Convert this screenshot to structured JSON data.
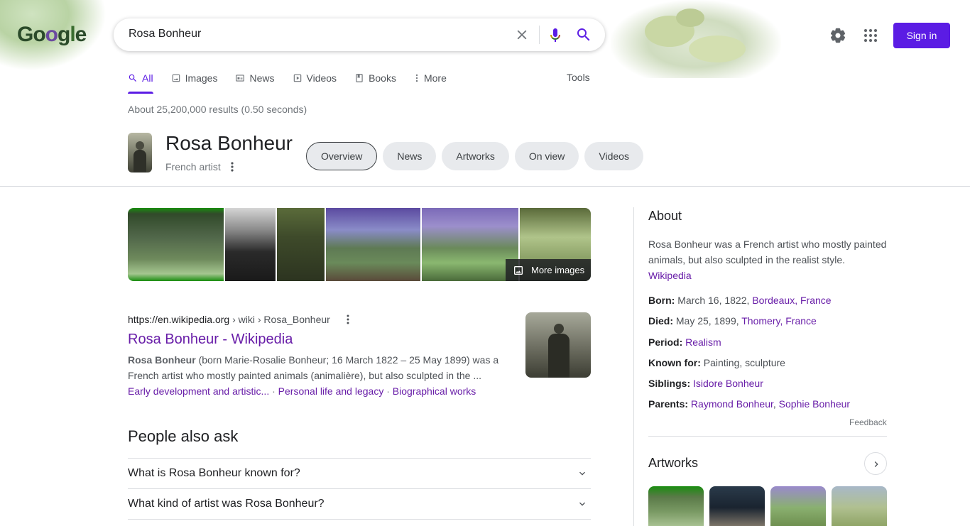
{
  "header": {
    "logo_text": "Google",
    "search_query": "Rosa Bonheur",
    "sign_in": "Sign in"
  },
  "tabs": [
    {
      "label": "All",
      "icon": "search-icon"
    },
    {
      "label": "Images",
      "icon": "image-icon"
    },
    {
      "label": "News",
      "icon": "news-icon"
    },
    {
      "label": "Videos",
      "icon": "video-icon"
    },
    {
      "label": "Books",
      "icon": "book-icon"
    },
    {
      "label": "More",
      "icon": "more-vert-icon"
    }
  ],
  "tools_label": "Tools",
  "result_stats": "About 25,200,000 results (0.50 seconds)",
  "entity": {
    "title": "Rosa Bonheur",
    "subtitle": "French artist",
    "chips": [
      "Overview",
      "News",
      "Artworks",
      "On view",
      "Videos"
    ]
  },
  "images": {
    "more_label": "More images"
  },
  "result": {
    "domain": "https://en.wikipedia.org",
    "path": " › wiki › Rosa_Bonheur",
    "title": "Rosa Bonheur - Wikipedia",
    "snippet_bold": "Rosa Bonheur",
    "snippet_rest": " (born Marie-Rosalie Bonheur; 16 March 1822 – 25 May 1899) was a French artist who mostly painted animals (animalière), but also sculpted in the ...",
    "sitelinks": [
      "Early development and artistic...",
      "Personal life and legacy",
      "Biographical works"
    ]
  },
  "paa": {
    "title": "People also ask",
    "questions": [
      "What is Rosa Bonheur known for?",
      "What kind of artist was Rosa Bonheur?"
    ]
  },
  "about": {
    "title": "About",
    "description": "Rosa Bonheur was a French artist who mostly painted animals, but also sculpted in the realist style.",
    "source": "Wikipedia",
    "facts": {
      "born_label": "Born:",
      "born_text": " March 16, 1822, ",
      "born_link": "Bordeaux, France",
      "died_label": "Died:",
      "died_text": " May 25, 1899, ",
      "died_link": "Thomery, France",
      "period_label": "Period:",
      "period_link": "Realism",
      "known_label": "Known for:",
      "known_text": " Painting, sculpture",
      "siblings_label": "Siblings:",
      "siblings_link": "Isidore Bonheur",
      "parents_label": "Parents:",
      "parents_link1": "Raymond Bonheur",
      "parents_sep": ", ",
      "parents_link2": "Sophie Bonheur"
    },
    "feedback": "Feedback"
  },
  "artworks": {
    "title": "Artworks"
  },
  "colors": {
    "accent": "#5b1ce4",
    "visited_link": "#681da8"
  }
}
